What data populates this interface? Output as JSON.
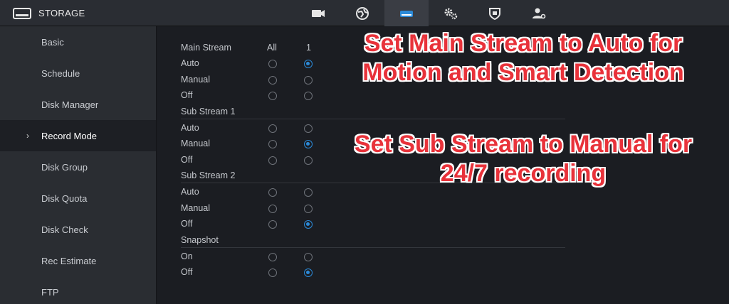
{
  "header": {
    "title": "STORAGE",
    "title_icon": "hdd-icon",
    "tabs": [
      {
        "icon": "camera-icon"
      },
      {
        "icon": "network-icon"
      },
      {
        "icon": "storage-icon",
        "active": true
      },
      {
        "icon": "settings-gears-icon"
      },
      {
        "icon": "shield-icon"
      },
      {
        "icon": "account-icon"
      }
    ]
  },
  "sidebar": {
    "items": [
      {
        "label": "Basic"
      },
      {
        "label": "Schedule"
      },
      {
        "label": "Disk Manager"
      },
      {
        "label": "Record Mode",
        "active": true
      },
      {
        "label": "Disk Group"
      },
      {
        "label": "Disk Quota"
      },
      {
        "label": "Disk Check"
      },
      {
        "label": "Rec Estimate"
      },
      {
        "label": "FTP"
      }
    ]
  },
  "record_mode": {
    "col_all": "All",
    "col_1": "1",
    "main_stream": {
      "title": "Main Stream",
      "options": [
        "Auto",
        "Manual",
        "Off"
      ],
      "selected": "Auto"
    },
    "sub_stream_1": {
      "title": "Sub Stream 1",
      "options": [
        "Auto",
        "Manual",
        "Off"
      ],
      "selected": "Manual"
    },
    "sub_stream_2": {
      "title": "Sub Stream 2",
      "options": [
        "Auto",
        "Manual",
        "Off"
      ],
      "selected": "Off"
    },
    "snapshot": {
      "title": "Snapshot",
      "options": [
        "On",
        "Off"
      ],
      "selected": "Off"
    }
  },
  "overlay": {
    "caption_1_line1": "Set Main Stream to Auto for",
    "caption_1_line2": "Motion and Smart Detection",
    "caption_2_line1": "Set Sub Stream to Manual for",
    "caption_2_line2": "24/7 recording"
  },
  "colors": {
    "accent": "#2b8ad8",
    "caption": "#e8323a"
  }
}
